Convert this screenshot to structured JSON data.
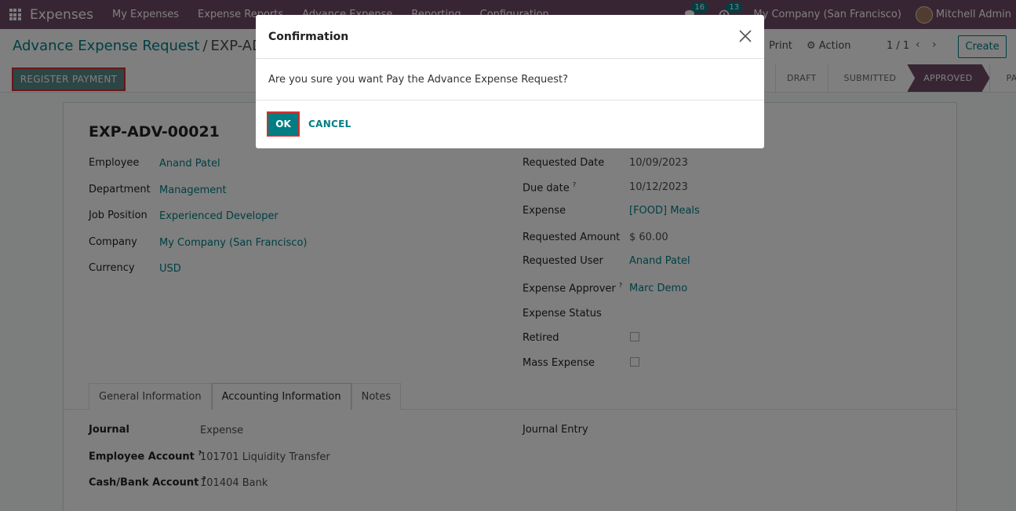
{
  "navbar": {
    "brand": "Expenses",
    "menu": [
      "My Expenses",
      "Expense Reports",
      "Advance Expense",
      "Reporting",
      "Configuration"
    ],
    "chat_count": "16",
    "activity_count": "13",
    "company": "My Company (San Francisco)",
    "user": "Mitchell Admin"
  },
  "control": {
    "breadcrumb_parent": "Advance Expense Request",
    "breadcrumb_sep": "/",
    "breadcrumb_current": "EXP-ADV-",
    "print_label": "Print",
    "action_label": "Action",
    "pager": "1 / 1",
    "create_label": "Create",
    "register_payment_label": "REGISTER PAYMENT",
    "stages": [
      "DRAFT",
      "SUBMITTED",
      "APPROVED",
      "PAID"
    ],
    "current_stage": "APPROVED"
  },
  "form": {
    "title": "EXP-ADV-00021",
    "left_fields": [
      {
        "label": "Employee",
        "value": "Anand Patel"
      },
      {
        "label": "Department",
        "value": "Management"
      },
      {
        "label": "Job Position",
        "value": "Experienced Developer"
      },
      {
        "label": "Company",
        "value": "My Company (San Francisco)"
      },
      {
        "label": "Currency",
        "value": "USD"
      }
    ],
    "right_fields": [
      {
        "label": "Requested Date",
        "value": "10/09/2023"
      },
      {
        "label": "Due date",
        "value": "10/12/2023"
      },
      {
        "label": "Expense",
        "value": "[FOOD] Meals"
      },
      {
        "label": "Requested Amount",
        "value": "$ 60.00"
      },
      {
        "label": "Requested User",
        "value": "Anand Patel"
      },
      {
        "label": "Expense Approver",
        "value": "Marc Demo"
      },
      {
        "label": "Expense Status",
        "value": ""
      },
      {
        "label": "Retired",
        "value": ""
      },
      {
        "label": "Mass Expense",
        "value": ""
      }
    ],
    "help_mark": "?",
    "tabs": [
      "General Information",
      "Accounting Information",
      "Notes"
    ],
    "active_tab": "Accounting Information",
    "accounting": {
      "journal_label": "Journal",
      "journal_value": "Expense",
      "employee_account_label": "Employee Account",
      "employee_account_value": "101701 Liquidity Transfer",
      "cash_bank_label": "Cash/Bank Account",
      "cash_bank_value": "101404 Bank",
      "journal_entry_label": "Journal Entry"
    }
  },
  "modal": {
    "title": "Confirmation",
    "message": "Are you sure you want Pay the Advance Expense Request?",
    "ok_label": "OK",
    "cancel_label": "CANCEL"
  },
  "colors": {
    "brand": "#714b67",
    "accent": "#017e84",
    "highlight": "#d32f2f"
  }
}
